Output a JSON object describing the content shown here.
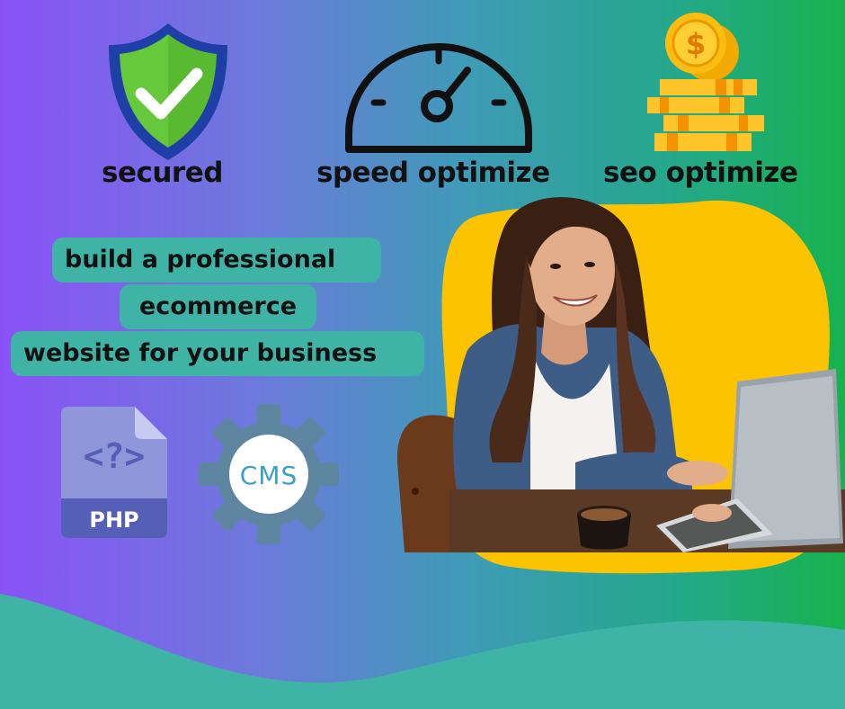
{
  "features": {
    "secured": "secured",
    "speed": "speed optimize",
    "seo": "seo optimize"
  },
  "headline": {
    "line1": "build a professional",
    "line2": "ecommerce",
    "line3": "website for your business"
  },
  "badges": {
    "php": "PHP",
    "cms": "CMS",
    "php_glyph": "<?>"
  },
  "icons": {
    "shield": "shield-check-icon",
    "speedometer": "speedometer-icon",
    "coins": "coin-stack-icon",
    "php_file": "php-file-icon",
    "cms_gear": "cms-gear-icon"
  },
  "colors": {
    "bg_left": "#8a52f6",
    "bg_right": "#17b24e",
    "teal_wave": "#3fb3a6",
    "headline_box": "#3fb3a6",
    "yellow_blob": "#fcc400",
    "shield_green": "#66c83b",
    "shield_border": "#1d3fa6"
  }
}
